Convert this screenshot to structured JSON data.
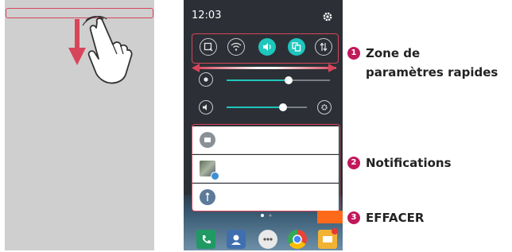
{
  "phone": {
    "time": "12:03"
  },
  "callouts": [
    {
      "number": "1",
      "title_line1": "Zone de",
      "title_line2": "paramètres rapides"
    },
    {
      "number": "2",
      "title": "Notifications"
    },
    {
      "number": "3",
      "title": "EFFACER"
    }
  ],
  "quick_settings": [
    {
      "icon": "screen-capture-icon",
      "state": "off"
    },
    {
      "icon": "wifi-icon",
      "state": "off"
    },
    {
      "icon": "sound-icon",
      "state": "on"
    },
    {
      "icon": "copy-icon",
      "state": "on"
    },
    {
      "icon": "data-transfer-icon",
      "state": "off"
    }
  ],
  "sliders": {
    "brightness_level": 0.6,
    "volume_level": 0.6
  },
  "colors": {
    "highlight": "#d8455a",
    "accent": "#1fc6bd",
    "callout_badge": "#c2185b",
    "clear_button": "#ff6a1a"
  }
}
